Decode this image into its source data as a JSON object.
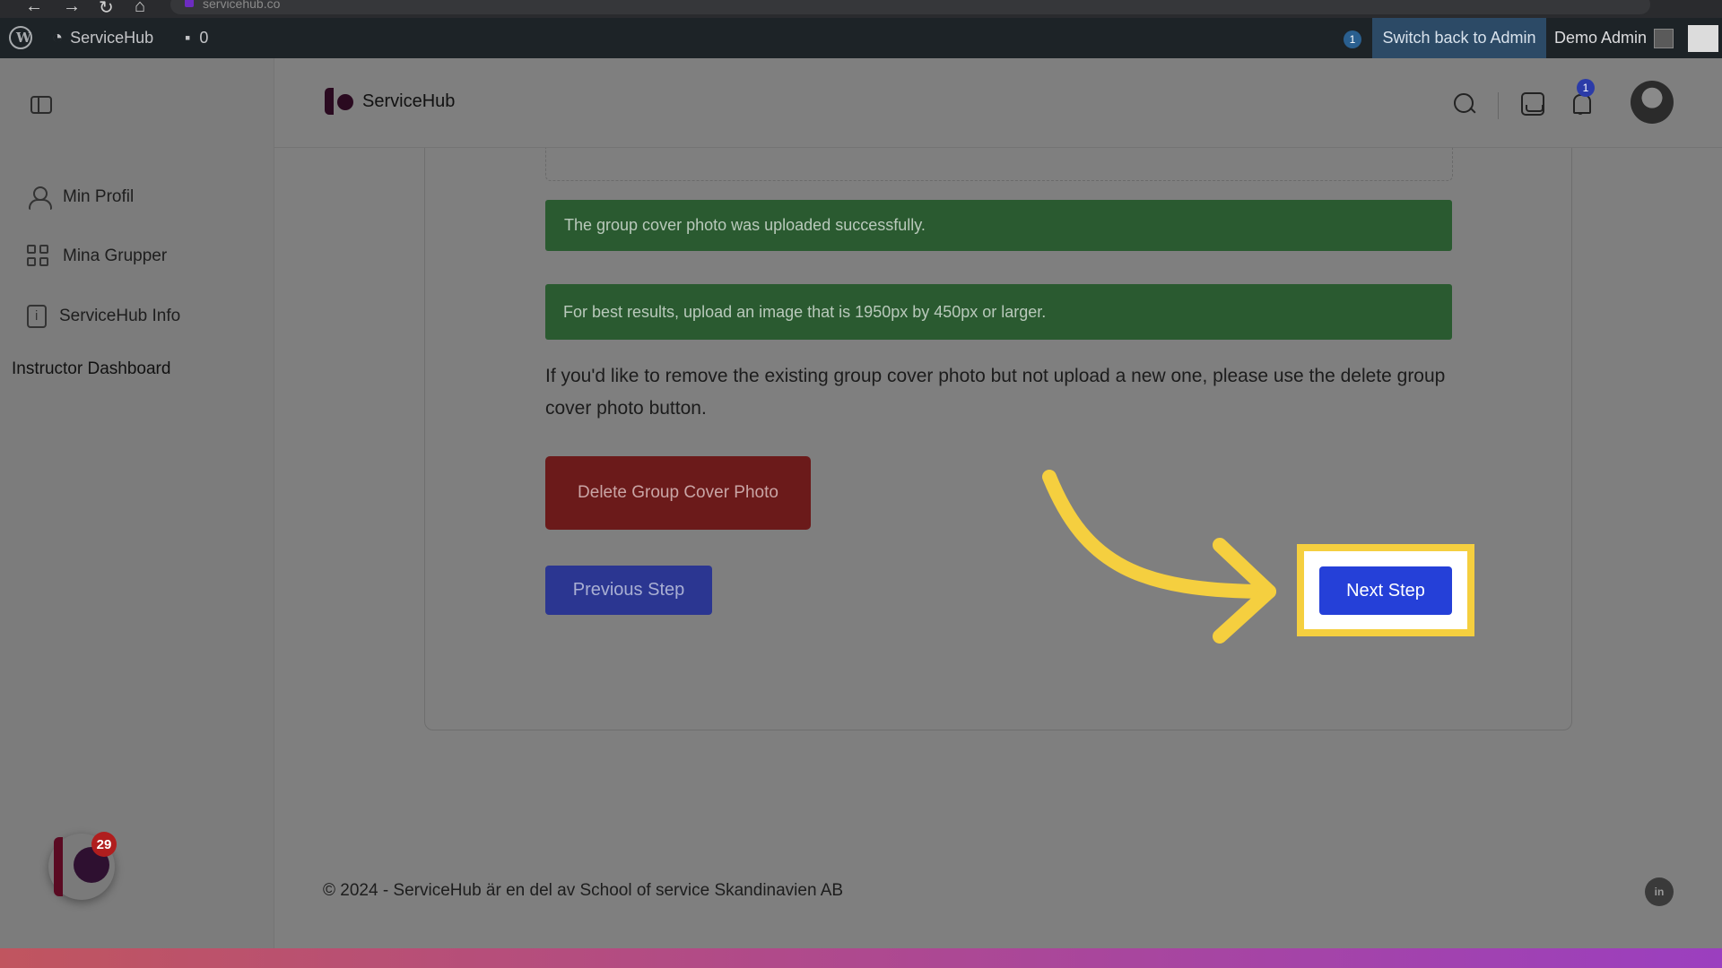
{
  "browser": {
    "url": "servicehub.co"
  },
  "admin_bar": {
    "site_name": "ServiceHub",
    "comments_count": "0",
    "updates_count": "1",
    "switch_label": "Switch back to Admin",
    "user_name": "Demo Admin"
  },
  "header": {
    "brand": "ServiceHub",
    "notification_count": "1"
  },
  "sidebar": {
    "items": [
      {
        "label": "Min Profil",
        "icon": "user-icon"
      },
      {
        "label": "Mina Grupper",
        "icon": "grid-icon"
      },
      {
        "label": "ServiceHub Info",
        "icon": "info-icon"
      }
    ],
    "instructor_link": "Instructor Dashboard",
    "floating_badge": "29"
  },
  "main": {
    "alert_success": "The group cover photo was uploaded successfully.",
    "alert_tip": "For best results, upload an image that is 1950px by 450px or larger.",
    "info": "If you'd like to remove the existing group cover photo but not upload a new one, please use the delete group cover photo button.",
    "delete_label": "Delete Group Cover Photo",
    "prev_label": "Previous Step",
    "next_label": "Next Step"
  },
  "footer": {
    "text": "© 2024 - ServiceHub är en del av School of service Skandinavien AB",
    "linkedin": "in"
  },
  "colors": {
    "highlight": "#f5cf3f",
    "primary": "#2540d8",
    "success": "#2a5a30",
    "danger": "#6b1a1a"
  }
}
